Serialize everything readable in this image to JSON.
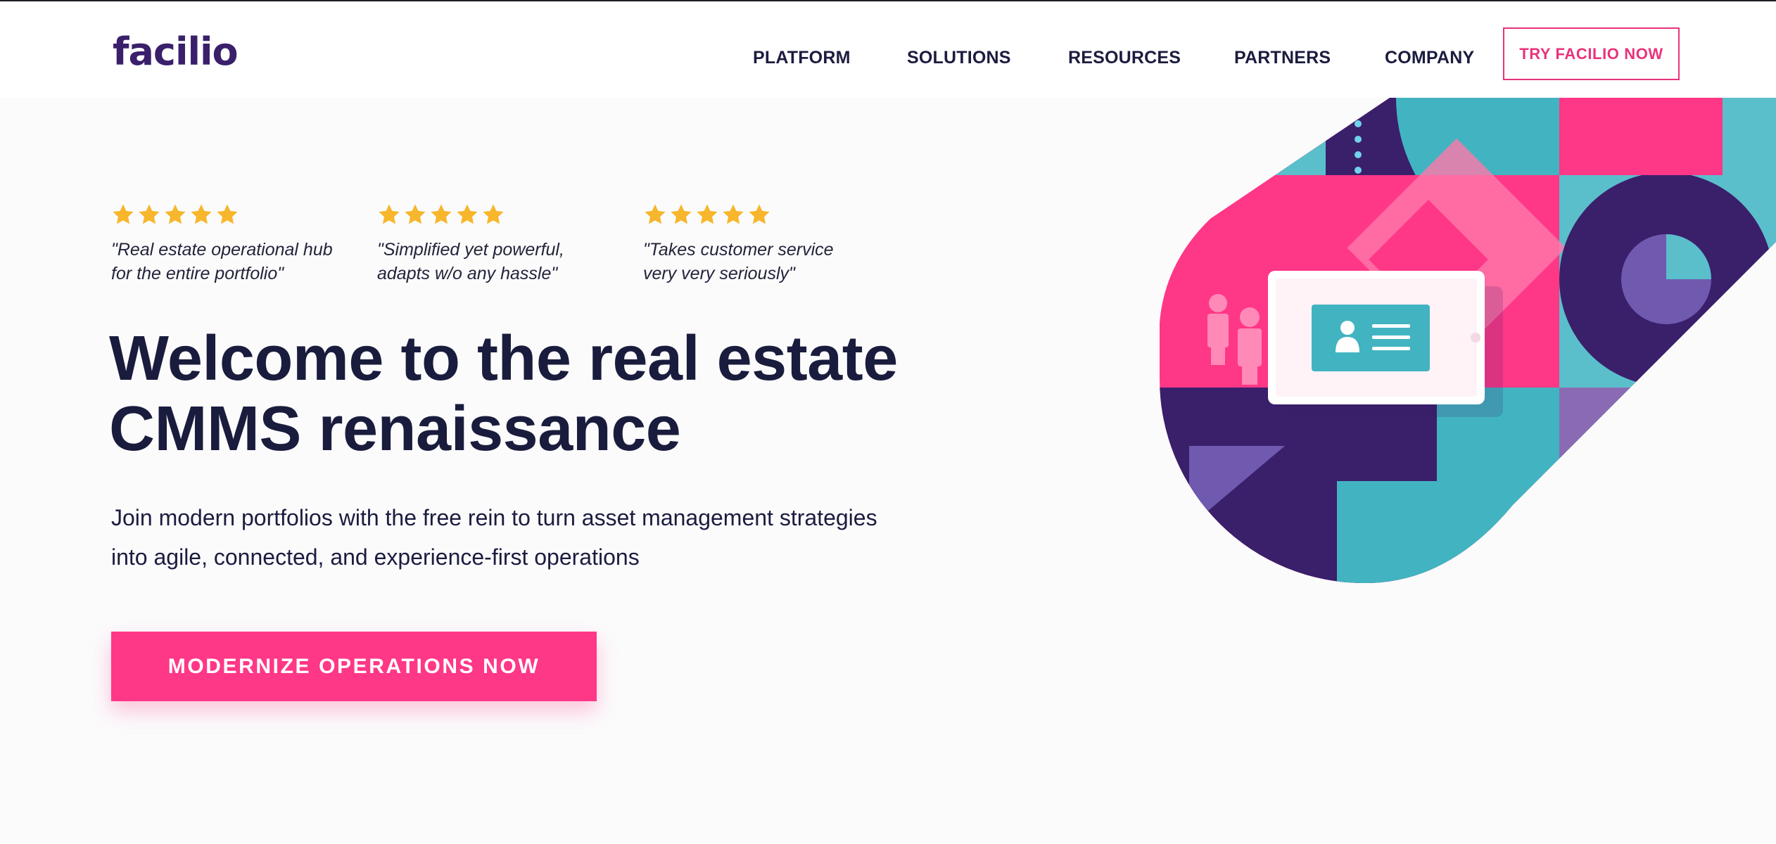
{
  "brand": {
    "logo_text": "facilio",
    "colors": {
      "navy": "#1a1c3d",
      "pink": "#ff3787",
      "purple": "#3a1f6b",
      "teal": "#42b4c1",
      "star": "#f7b62c"
    }
  },
  "nav": {
    "items": [
      {
        "label": "PLATFORM"
      },
      {
        "label": "SOLUTIONS"
      },
      {
        "label": "RESOURCES"
      },
      {
        "label": "PARTNERS"
      },
      {
        "label": "COMPANY"
      }
    ],
    "cta_label": "TRY FACILIO NOW"
  },
  "reviews": [
    {
      "rating": 5,
      "line1": "\"Real estate operational hub",
      "line2": "for the entire portfolio\""
    },
    {
      "rating": 5,
      "line1": "\"Simplified yet powerful,",
      "line2": "adapts w/o any hassle\""
    },
    {
      "rating": 5,
      "line1": "\"Takes customer service",
      "line2": "very very seriously\""
    }
  ],
  "hero": {
    "headline_line1": "Welcome to the real estate",
    "headline_line2": "CMMS renaissance",
    "subtext_line1": "Join modern portfolios with the free rein to turn asset management strategies",
    "subtext_line2": "into agile, connected, and experience-first operations",
    "cta_label": "MODERNIZE OPERATIONS NOW"
  },
  "illustration": {
    "icon": "building-ops-illustration"
  }
}
